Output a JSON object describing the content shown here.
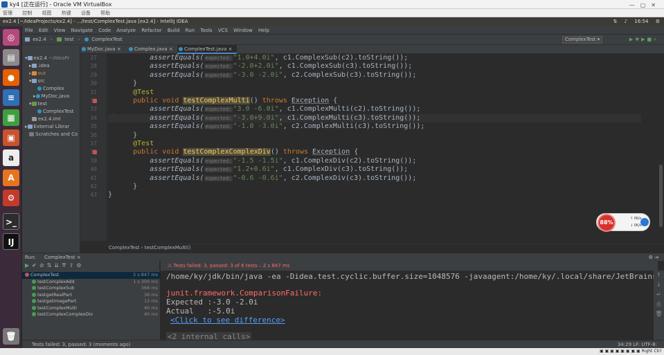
{
  "vbox": {
    "title": "ky4 [正在运行] - Oracle VM VirtualBox",
    "menu": [
      "管理",
      "控制",
      "视图",
      "热键",
      "设备",
      "帮助"
    ],
    "host_key": "Right Ctrl"
  },
  "ubuntu_panel": {
    "window_title": "ex2.4 [~/IdeaProjects/ex2.4] - .../test/ComplexTest.java [ex2.4] - IntelliJ IDEA",
    "clock": "16:54"
  },
  "ide": {
    "menu": [
      "File",
      "Edit",
      "View",
      "Navigate",
      "Code",
      "Analyze",
      "Refactor",
      "Build",
      "Run",
      "Tools",
      "VCS",
      "Window",
      "Help"
    ],
    "nav_crumbs": [
      "ex2.4",
      "test",
      "ComplexTest"
    ],
    "run_config": "ComplexTest ▾",
    "project_tree": [
      {
        "label": "ex2.4",
        "suffix": "~/IdeaPr",
        "indent": 0,
        "icon": "folder"
      },
      {
        "label": ".idea",
        "indent": 1,
        "icon": "folder"
      },
      {
        "label": "out",
        "indent": 1,
        "icon": "folder-orange"
      },
      {
        "label": "src",
        "indent": 1,
        "icon": "folder"
      },
      {
        "label": "Complex",
        "indent": 2,
        "icon": "class"
      },
      {
        "label": "MyDoc.java",
        "indent": 2,
        "icon": "class"
      },
      {
        "label": "test",
        "indent": 1,
        "icon": "folder-green"
      },
      {
        "label": "ComplexTest",
        "indent": 2,
        "icon": "class"
      },
      {
        "label": "ex2.4.iml",
        "indent": 1,
        "icon": "file"
      },
      {
        "label": "External Librar",
        "indent": 0,
        "icon": "folder"
      },
      {
        "label": "Scratches and Co",
        "indent": 0,
        "icon": "folder"
      }
    ],
    "tabs": [
      "MyDoc.java",
      "Complex.java",
      "ComplexTest.java"
    ],
    "line_numbers": [
      "27",
      "28",
      "29",
      "30",
      "31",
      "32",
      "33",
      "34",
      "35",
      "36",
      "37",
      "38",
      "39",
      "40",
      "41",
      "42",
      "43"
    ],
    "code": {
      "l27": {
        "call": "assertEquals(",
        "hint": "expected:",
        "str": "\"1.0+4.0i\"",
        "rest": ", c1.ComplexSub(c2).toString());"
      },
      "l28": {
        "call": "assertEquals(",
        "hint": "expected:",
        "str": "\"-2.0+2.0i\"",
        "rest": ", c1.ComplexSub(c3).toString());"
      },
      "l29": {
        "call": "assertEquals(",
        "hint": "expected:",
        "str": "\"-3.0 -2.0i\"",
        "rest": ", c2.ComplexSub(c3).toString());"
      },
      "l30": "}",
      "l31": "@Test",
      "l32": {
        "kw1": "public void ",
        "name": "testComplexMulti",
        "mid": "() ",
        "kw2": "throws ",
        "exc": "Exception",
        "end": " {"
      },
      "l33": {
        "call": "assertEquals(",
        "hint": "expected:",
        "str": "\"3.0 -6.0i\"",
        "rest": ", c1.ComplexMulti(c2).toString());"
      },
      "l34": {
        "call": "assertEquals(",
        "hint": "expected:",
        "str": "\"-3.0+9.0i\"",
        "rest": ", c1.ComplexMulti(c3).toString());"
      },
      "l35": {
        "call": "assertEquals(",
        "hint": "expected:",
        "str": "\"-1.0 -3.0i\"",
        "rest": ", c2.ComplexMulti(c3).toString());"
      },
      "l36": "}",
      "l37": "@Test",
      "l38": {
        "kw1": "public void ",
        "name": "testComplexComplexDiv",
        "mid": "() ",
        "kw2": "throws ",
        "exc": "Exception",
        "end": " {"
      },
      "l39": {
        "call": "assertEquals(",
        "hint": "expected:",
        "str": "\"-1.5 -1.5i\"",
        "rest": ", c1.ComplexDiv(c2).toString());"
      },
      "l40": {
        "call": "assertEquals(",
        "hint": "expected:",
        "str": "\"1.2+0.6i\"",
        "rest": ", c1.ComplexDiv(c3).toString());"
      },
      "l41": {
        "call": "assertEquals(",
        "hint": "expected:",
        "str": "\"-0.6 -0.6i\"",
        "rest": ", c2.ComplexDiv(c3).toString());"
      },
      "l42": "}",
      "l43": "}"
    },
    "breadcrumb": "ComplexTest  ›  testComplexMulti()",
    "net_widget": {
      "percent": "88%",
      "up": "0K/s",
      "down": "0K/s"
    },
    "run_panel": {
      "label": "Run:",
      "tab": "ComplexTest",
      "status": "Tests failed: 3, passed: 3 of 6 tests – 2 s 847 ms"
    },
    "test_tree": [
      {
        "name": "ComplexTest",
        "time": "2 s 847 ms",
        "ok": false,
        "indent": 0
      },
      {
        "name": "testComplexAdd",
        "time": "1 s 300 ms",
        "ok": true,
        "indent": 1
      },
      {
        "name": "testComplexSub",
        "time": "368 ms",
        "ok": true,
        "indent": 1
      },
      {
        "name": "testgetRealPart",
        "time": "36 ms",
        "ok": true,
        "indent": 1
      },
      {
        "name": "testgetImagePart",
        "time": "12 ms",
        "ok": true,
        "indent": 1
      },
      {
        "name": "testComplexMulti",
        "time": "40 ms",
        "ok": true,
        "indent": 1
      },
      {
        "name": "testComplexComplexDiv",
        "time": "40 ms",
        "ok": true,
        "indent": 1
      }
    ],
    "console": {
      "cmd": "/home/ky/jdk/bin/java -ea -Didea.test.cyclic.buffer.size=1048576 -javaagent:/home/ky/.local/share/JetBrains/T",
      "exception": "junit.framework.ComparisonFailure:",
      "expected": "Expected :-3.0 -2.0i",
      "actual": "Actual   :-5.0i",
      "link": "<Click to see difference>",
      "fold": "<2 internal calls>"
    },
    "status_bar": {
      "left": "Tests failed: 3, passed: 3 (moments ago)",
      "right": "34:29  LF:  UTF-8:"
    }
  }
}
